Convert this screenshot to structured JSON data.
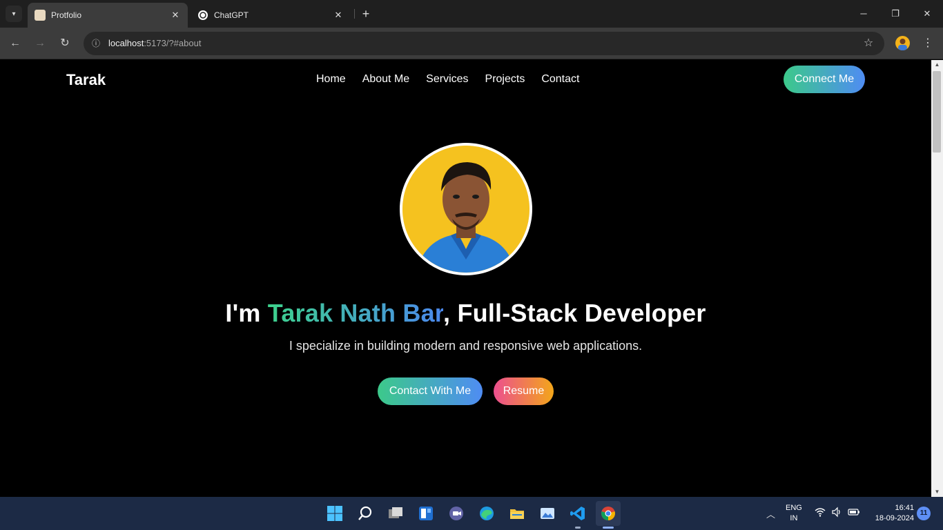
{
  "browser": {
    "tabs": [
      {
        "title": "Protfolio",
        "active": true
      },
      {
        "title": "ChatGPT",
        "active": false
      }
    ],
    "url_host": "localhost",
    "url_rest": ":5173/?#about",
    "icons": [
      "tab-search-icon",
      "close-icon",
      "plus-icon",
      "minimize-icon",
      "restore-icon",
      "back-icon",
      "forward-icon",
      "reload-icon",
      "site-info-icon",
      "bookmark-star-icon",
      "menu-dots-icon"
    ]
  },
  "site": {
    "brand": "Tarak",
    "nav": [
      "Home",
      "About Me",
      "Services",
      "Projects",
      "Contact"
    ],
    "connect_label": "Connect Me",
    "headline_prefix": "I'm ",
    "headline_name": "Tarak Nath Bar",
    "headline_suffix": ", Full-Stack Developer",
    "tagline": "I specialize in building modern and responsive web applications.",
    "contact_label": "Contact With Me",
    "resume_label": "Resume",
    "colors": {
      "green": "#3cc98a",
      "blue": "#4f8cf3",
      "pink": "#ec4f8f",
      "orange": "#f3a61a",
      "avatar_bg": "#f5c21f"
    }
  },
  "taskbar": {
    "apps": [
      "start-icon",
      "search-icon",
      "task-view-icon",
      "widgets-icon",
      "teams-chat-icon",
      "edge-icon",
      "file-explorer-icon",
      "photos-icon",
      "vscode-icon",
      "chrome-icon"
    ],
    "lang_top": "ENG",
    "lang_bottom": "IN",
    "time": "16:41",
    "date": "18-09-2024",
    "notifications": "11"
  }
}
